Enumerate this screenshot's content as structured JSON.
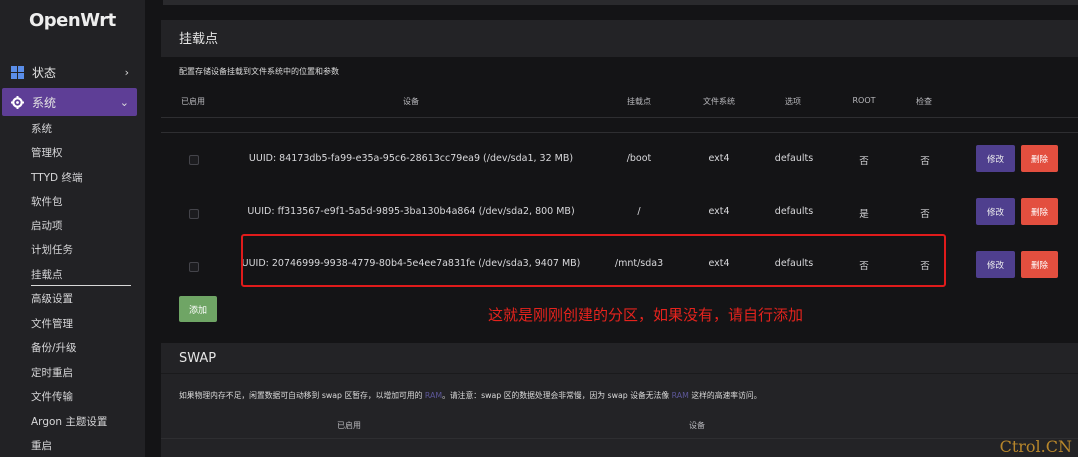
{
  "app": {
    "logo": "OpenWrt"
  },
  "sidebar": {
    "status": {
      "label": "状态",
      "icon": "dashboard-icon"
    },
    "system": {
      "label": "系统",
      "icon": "gear-icon"
    },
    "sub_items": [
      "系统",
      "管理权",
      "TTYD 终端",
      "软件包",
      "启动项",
      "计划任务",
      "挂载点",
      "高级设置",
      "文件管理",
      "备份/升级",
      "定时重启",
      "文件传输",
      "Argon 主题设置",
      "重启"
    ],
    "active_sub": "挂载点"
  },
  "mount": {
    "title": "挂载点",
    "description": "配置存储设备挂载到文件系统中的位置和参数",
    "headers": [
      "已启用",
      "设备",
      "挂载点",
      "文件系统",
      "选项",
      "ROOT",
      "检查"
    ],
    "rows": [
      {
        "device": "UUID: 84173db5-fa99-e35a-95c6-28613cc79ea9 (/dev/sda1, 32 MB)",
        "mount": "/boot",
        "fs": "ext4",
        "options": "defaults",
        "root": "否",
        "check": "否"
      },
      {
        "device": "UUID: ff313567-e9f1-5a5d-9895-3ba130b4a864 (/dev/sda2, 800 MB)",
        "mount": "/",
        "fs": "ext4",
        "options": "defaults",
        "root": "是",
        "check": "否"
      },
      {
        "device": "UUID: 20746999-9938-4779-80b4-5e4ee7a831fe (/dev/sda3, 9407 MB)",
        "mount": "/mnt/sda3",
        "fs": "ext4",
        "options": "defaults",
        "root": "否",
        "check": "否"
      }
    ],
    "edit_label": "修改",
    "delete_label": "删除",
    "add_label": "添加"
  },
  "annotation": "这就是刚刚创建的分区，如果没有，请自行添加",
  "swap": {
    "title": "SWAP",
    "description_parts": [
      "如果物理内存不足，闲置数据可自动移到 swap 区暂存，以增加可用的 ",
      "RAM",
      "。请注意：swap 区的数据处理会非常慢，因为 swap 设备无法像 ",
      "RAM",
      " 这样的高速率访问。"
    ],
    "headers": [
      "已启用",
      "设备"
    ]
  },
  "watermark": "Ctrol.CN",
  "colors": {
    "accent": "#5e3e96",
    "edit": "#4f3f8e",
    "delete": "#e34f3f",
    "add": "#6fa565",
    "highlight": "#e01b1b",
    "watermark": "#b7862b"
  }
}
